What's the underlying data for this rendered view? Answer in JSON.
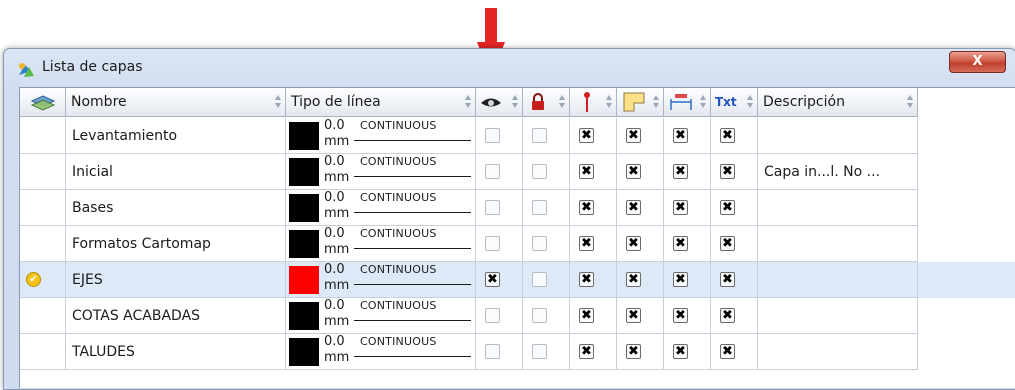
{
  "window": {
    "title": "Lista de capas",
    "close_label": "X"
  },
  "columns": {
    "nombre": "Nombre",
    "tipo": "Tipo de línea",
    "txt": "Txt",
    "descripcion": "Descripción"
  },
  "icons": {
    "title": "app-layers-icon",
    "header_first": "layers-stack-icon",
    "visible": "eye-icon",
    "lock": "padlock-icon",
    "line": "pin-marker-icon",
    "fill": "fill-shape-icon",
    "dim": "dimension-icon",
    "current": "check-badge-icon",
    "annotation": "red-down-arrow-icon"
  },
  "colors": {
    "accent_arrow": "#e32626",
    "selected_row": "#dde9f6",
    "swatch_red": "#ff0000",
    "swatch_black": "#000000"
  },
  "rows": [
    {
      "name": "Levantamiento",
      "lt_value": "0.0",
      "lt_unit": "mm",
      "lt_name": "CONTINUOUS",
      "desc": "",
      "marks": [
        "",
        "",
        "✖",
        "✖",
        "✖",
        "✖"
      ]
    },
    {
      "name": "Inicial",
      "lt_value": "0.0",
      "lt_unit": "mm",
      "lt_name": "CONTINUOUS",
      "desc": "Capa in...l. No ...",
      "marks": [
        "",
        "",
        "✖",
        "✖",
        "✖",
        "✖"
      ]
    },
    {
      "name": "Bases",
      "lt_value": "0.0",
      "lt_unit": "mm",
      "lt_name": "CONTINUOUS",
      "desc": "",
      "marks": [
        "",
        "",
        "✖",
        "✖",
        "✖",
        "✖"
      ]
    },
    {
      "name": "Formatos Cartomap",
      "lt_value": "0.0",
      "lt_unit": "mm",
      "lt_name": "CONTINUOUS",
      "desc": "",
      "marks": [
        "",
        "",
        "✖",
        "✖",
        "✖",
        "✖"
      ]
    },
    {
      "name": "EJES",
      "lt_value": "0.0",
      "lt_unit": "mm",
      "lt_name": "CONTINUOUS",
      "desc": "",
      "marks": [
        "✖",
        "",
        "✖",
        "✖",
        "✖",
        "✖"
      ]
    },
    {
      "name": "COTAS ACABADAS",
      "lt_value": "0.0",
      "lt_unit": "mm",
      "lt_name": "CONTINUOUS",
      "desc": "",
      "marks": [
        "",
        "",
        "✖",
        "✖",
        "✖",
        "✖"
      ]
    },
    {
      "name": "TALUDES",
      "lt_value": "0.0",
      "lt_unit": "mm",
      "lt_name": "CONTINUOUS",
      "desc": "",
      "marks": [
        "",
        "",
        "✖",
        "✖",
        "✖",
        "✖"
      ]
    }
  ]
}
